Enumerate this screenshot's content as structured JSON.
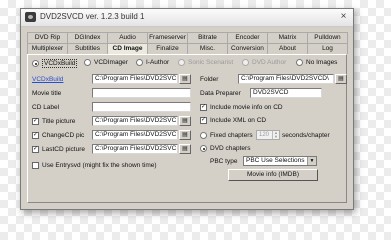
{
  "window": {
    "title": "DVD2SVCD ver. 1.2.3 build 1",
    "close_glyph": "×"
  },
  "tabs": {
    "row1": [
      "DVD Rip",
      "DGIndex",
      "Audio",
      "Frameserver",
      "Bitrate",
      "Encoder",
      "Matrix",
      "Pulldown"
    ],
    "row2": [
      "Multiplexer",
      "Subtitles",
      "CD Image",
      "Finalize",
      "Misc.",
      "Conversion",
      "About",
      "Log"
    ],
    "active": "CD Image"
  },
  "authoring": {
    "options": [
      {
        "label": "VCDxBuild",
        "selected": true,
        "enabled": true
      },
      {
        "label": "VCDImager",
        "selected": false,
        "enabled": true
      },
      {
        "label": "I-Author",
        "selected": false,
        "enabled": true
      },
      {
        "label": "Sonic Scenarist",
        "selected": false,
        "enabled": false
      },
      {
        "label": "DVD Author",
        "selected": false,
        "enabled": false
      },
      {
        "label": "No Images",
        "selected": false,
        "enabled": true
      }
    ]
  },
  "left": {
    "link_label": "VCDxBuild",
    "program_path": "C:\\Program Files\\DVD2SVC",
    "movie_title_label": "Movie title",
    "movie_title_value": "",
    "cd_label_label": "CD Label",
    "cd_label_value": "",
    "title_picture": {
      "label": "Title picture",
      "checked": true,
      "path": "C:\\Program Files\\DVD2SVC"
    },
    "changecd_picture": {
      "label": "ChangeCD pic",
      "checked": true,
      "path": "C:\\Program Files\\DVD2SVC"
    },
    "lastcd_picture": {
      "label": "LastCD picture",
      "checked": true,
      "path": "C:\\Program Files\\DVD2SVC"
    },
    "use_entrysvd": {
      "label": "Use Entrysvd (might fix the shown time)",
      "checked": false
    }
  },
  "right": {
    "folder_label": "Folder",
    "folder_path": "C:\\Program Files\\DVD2SVCD\\",
    "data_preparer_label": "Data Preparer",
    "data_preparer_value": "DVD2SVCD",
    "include_movie_info": {
      "label": "Include movie info on CD",
      "checked": true
    },
    "include_xml": {
      "label": "Include XML on CD",
      "checked": true
    },
    "fixed_chapters": {
      "label": "Fixed chapters",
      "selected": false,
      "value": "120",
      "suffix": "seconds/chapter"
    },
    "dvd_chapters": {
      "label": "DVD chapters",
      "selected": true
    },
    "pbc_type_label": "PBC type",
    "pbc_type_value": "PBC Use Selections",
    "movie_info_button": "Movie info (IMDB)"
  },
  "icons": {
    "browse": "folder-icon",
    "check": "✓",
    "dropdown": "▼"
  }
}
